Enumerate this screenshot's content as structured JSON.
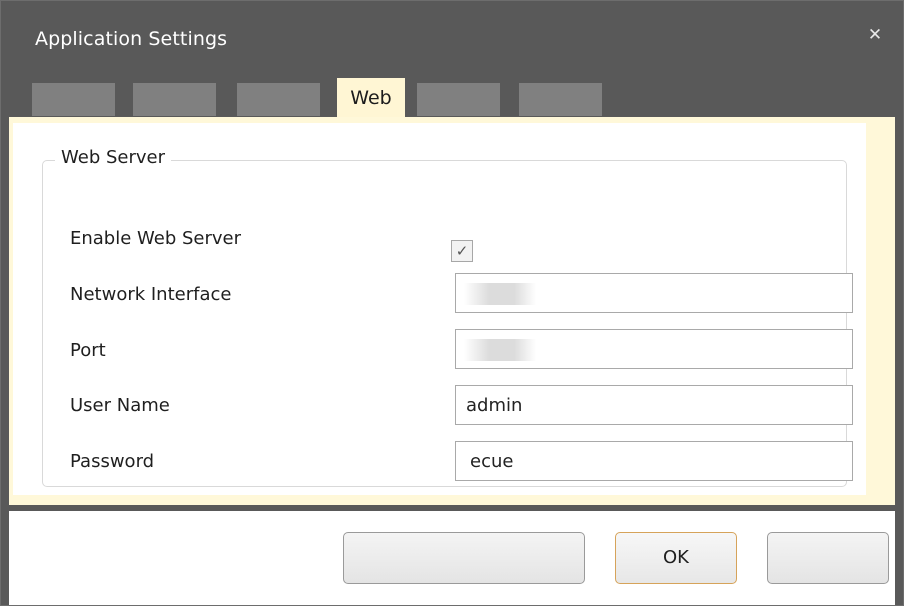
{
  "window": {
    "title": "Application Settings"
  },
  "tabs": [
    {
      "label": ""
    },
    {
      "label": ""
    },
    {
      "label": ""
    },
    {
      "label": "Web",
      "active": true
    },
    {
      "label": ""
    },
    {
      "label": ""
    }
  ],
  "web_server": {
    "group_label": "Web Server",
    "enable_label": "Enable Web Server",
    "enable_checked": true,
    "check_glyph": "✓",
    "network_interface_label": "Network Interface",
    "network_interface_value": "",
    "port_label": "Port",
    "port_value": "",
    "username_label": "User Name",
    "username_value": "admin",
    "password_label": "Password",
    "password_value": "ecue"
  },
  "footer": {
    "left_button_label": "",
    "ok_label": "OK",
    "cancel_label": ""
  },
  "icons": {
    "close": "close-icon",
    "check": "checkbox-checked"
  },
  "colors": {
    "title_bar": "#595959",
    "active_tab": "#fff6d4",
    "accent_border": "#d6a35a"
  }
}
